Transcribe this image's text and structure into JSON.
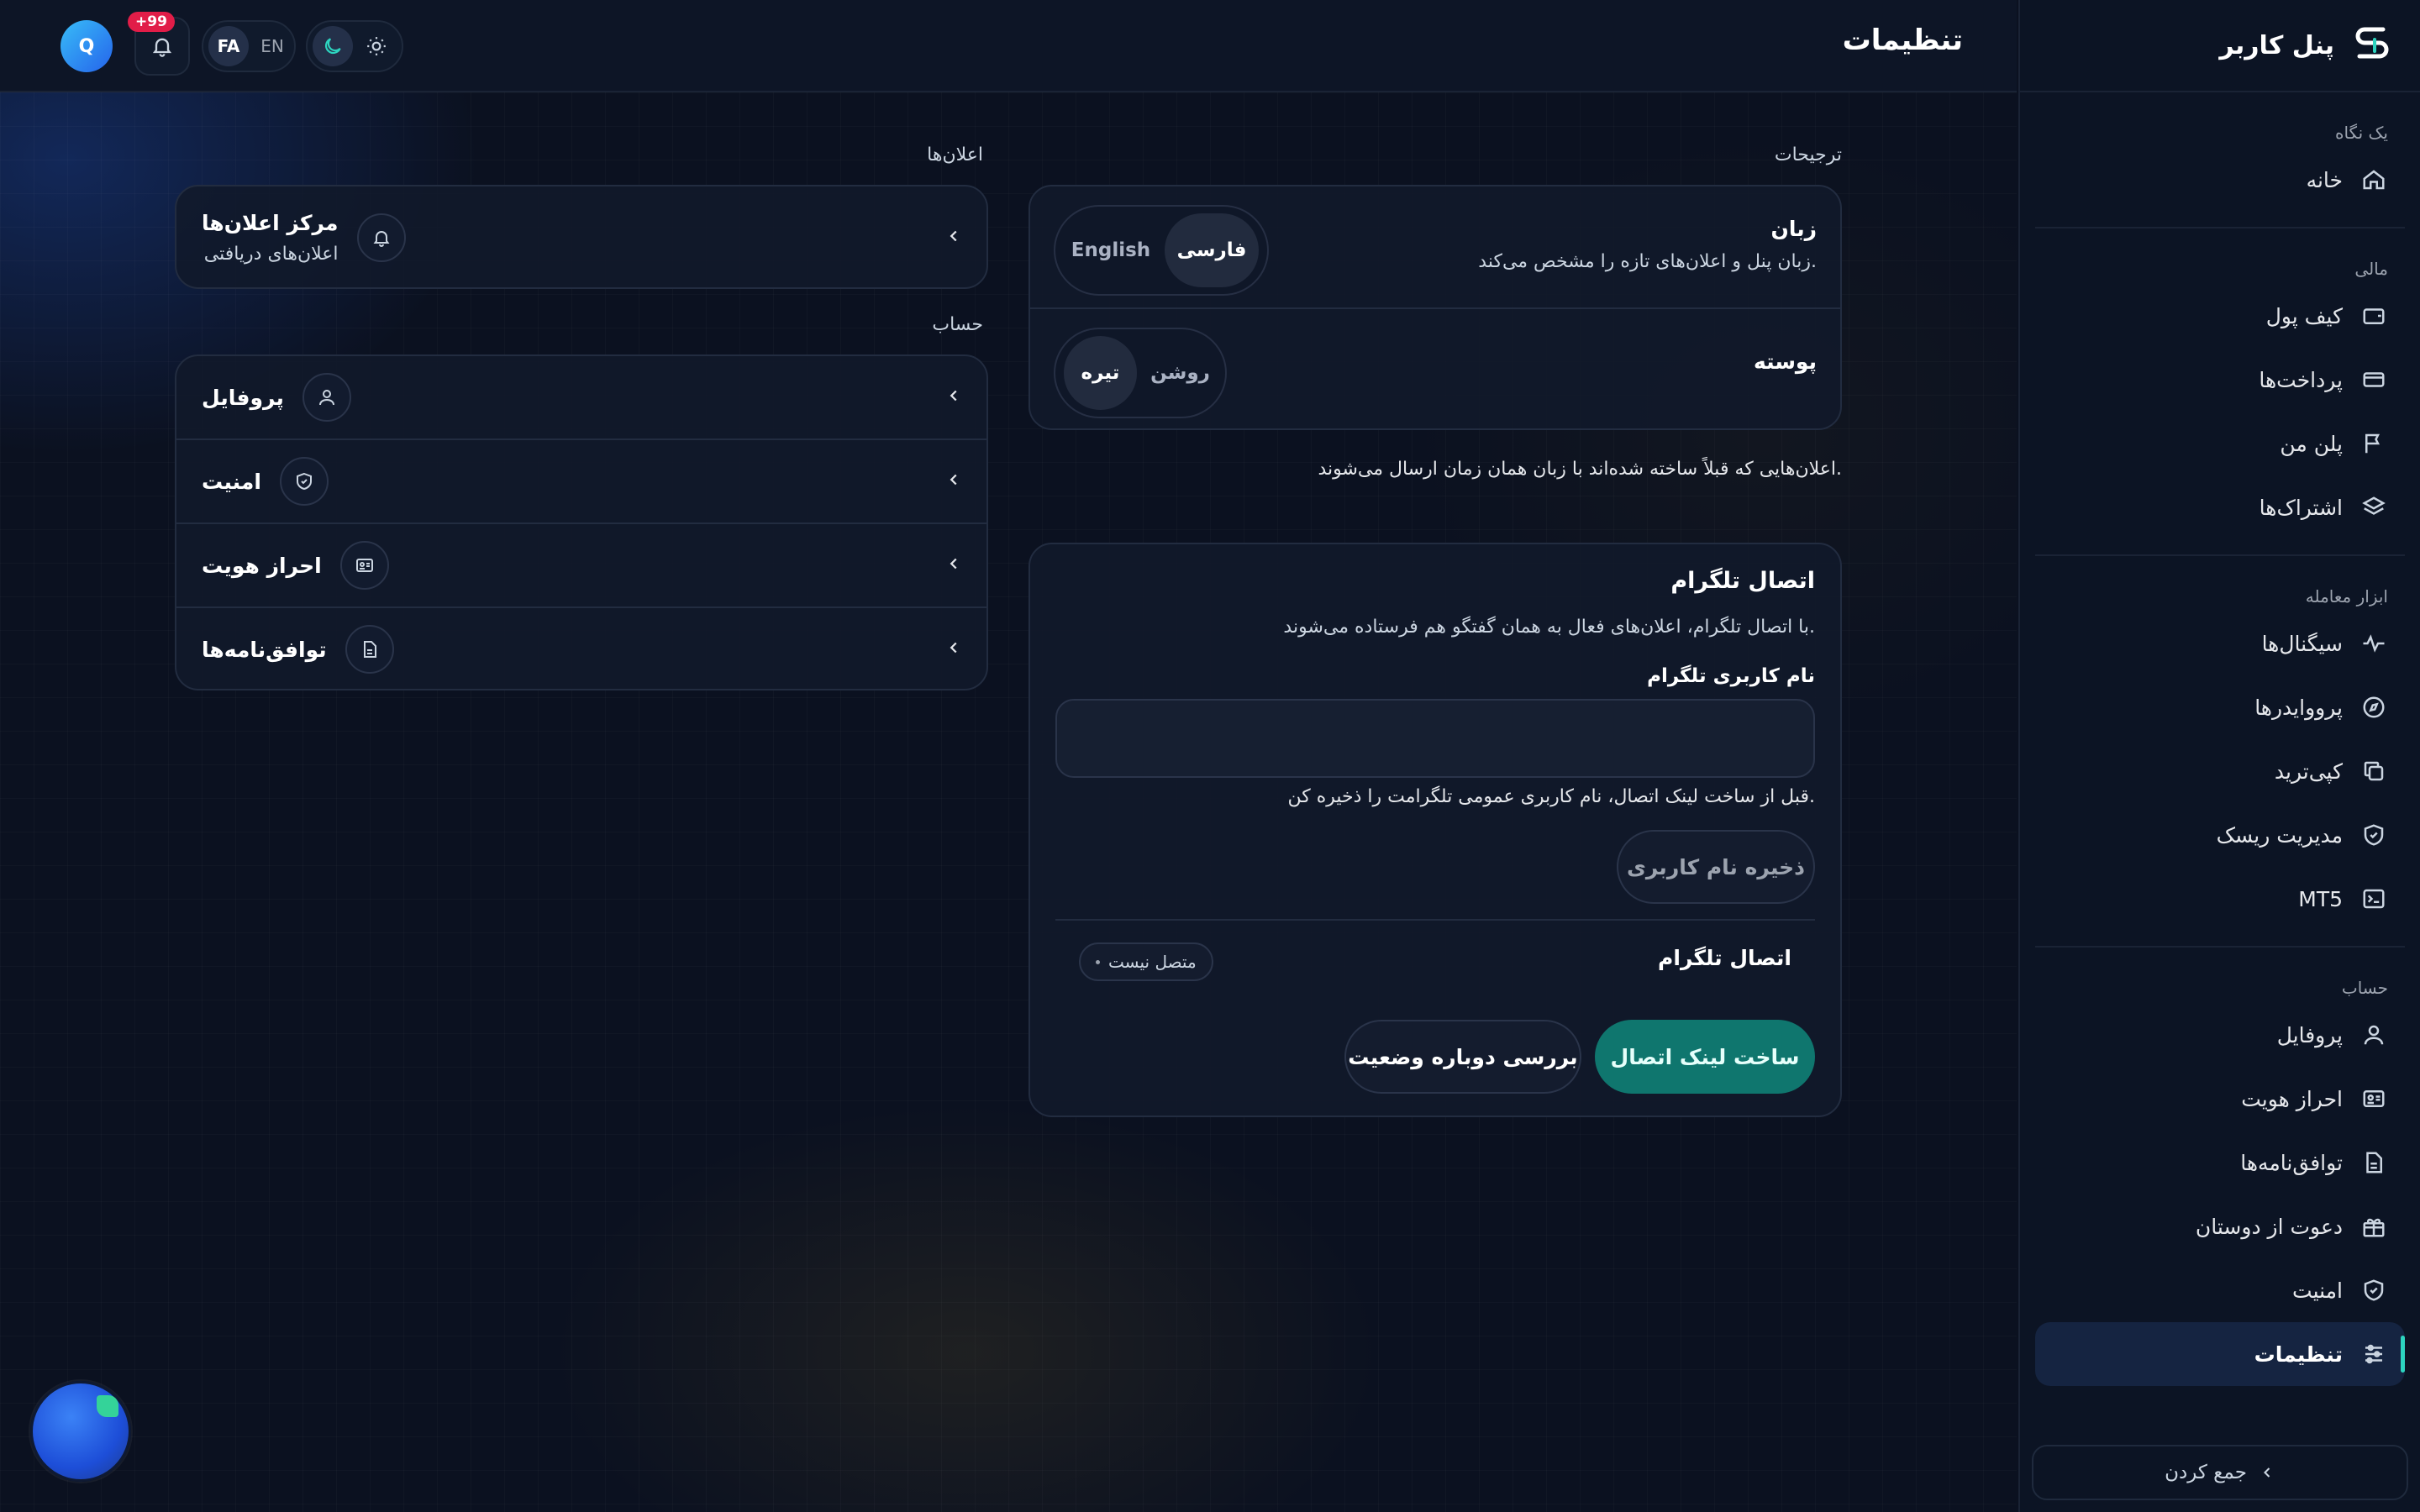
{
  "topbar": {
    "page_title": "تنظیمات",
    "avatar_initial": "Q",
    "notifications_badge": "+99",
    "lang_options": [
      "FA",
      "EN"
    ],
    "lang_active": "FA"
  },
  "sidebar": {
    "brand_name": "پنل کاربر",
    "sections": {
      "overview": "یک نگاه",
      "finance": "مالی",
      "trading": "ابزار معامله",
      "account": "حساب"
    },
    "items": {
      "home": "خانه",
      "wallet": "کیف پول",
      "payments": "پرداخت‌ها",
      "my_plan": "پلن من",
      "subscriptions": "اشتراک‌ها",
      "signals": "سیگنال‌ها",
      "providers": "پرووایدرها",
      "copytrade": "کپی‌ترید",
      "risk": "مدیریت ریسک",
      "mt5": "MT5",
      "profile": "پروفایل",
      "kyc": "احراز هویت",
      "agreements": "توافق‌نامه‌ها",
      "invite": "دعوت از دوستان",
      "security": "امنیت",
      "settings": "تنظیمات"
    },
    "collapse_label": "جمع کردن"
  },
  "preferences": {
    "section_label": "ترجیحات",
    "language_title": "زبان",
    "language_desc": "زبان پنل و اعلان‌های تازه را مشخص می‌کند.",
    "language_options": [
      "فارسی",
      "English"
    ],
    "language_selected": "فارسی",
    "skin_title": "پوسته",
    "skin_options": [
      "روشن",
      "تیره"
    ],
    "skin_selected": "تیره",
    "note": "اعلان‌هایی که قبلاً ساخته شده‌اند با زبان همان زمان ارسال می‌شوند."
  },
  "telegram": {
    "title": "اتصال تلگرام",
    "desc": "با اتصال تلگرام، اعلان‌های فعال به همان گفتگو هم فرستاده می‌شوند.",
    "username_label": "نام کاربری تلگرام",
    "username_value": "",
    "username_hint": "قبل از ساخت لینک اتصال، نام کاربری عمومی تلگرامت را ذخیره کن.",
    "save_button": "ذخیره نام کاربری",
    "status_title": "اتصال تلگرام",
    "status_badge": "متصل نیست",
    "create_link_button": "ساخت لینک اتصال",
    "recheck_button": "بررسی دوباره وضعیت"
  },
  "notifications": {
    "section_label": "اعلان‌ها",
    "center_title": "مرکز اعلان‌ها",
    "center_desc": "اعلان‌های دریافتی"
  },
  "account": {
    "section_label": "حساب",
    "rows": [
      "پروفایل",
      "امنیت",
      "احراز هویت",
      "توافق‌نامه‌ها"
    ]
  },
  "colors": {
    "accent": "#0f766e",
    "active_indicator": "#2dd4bf",
    "badge": "#e11d48"
  }
}
